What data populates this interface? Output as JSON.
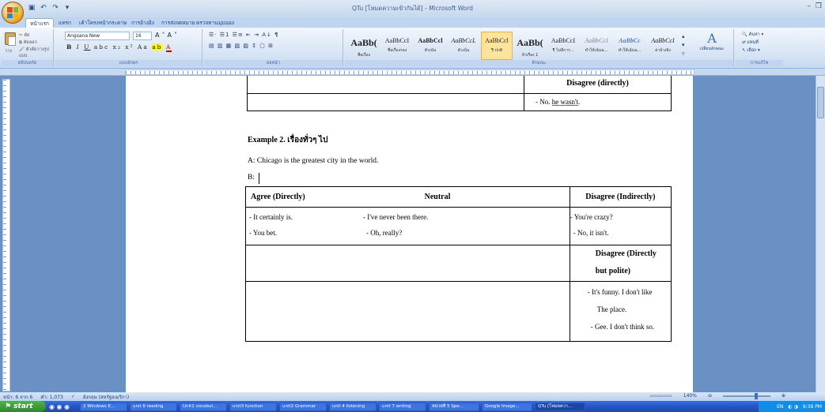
{
  "window": {
    "title": "QTu [โหมดความเข้ากันได้] - Microsoft Word"
  },
  "ribbon": {
    "tabs": [
      "หน้าแรก",
      "แทรก",
      "เค้าโครงหน้ากระดาษ",
      "การอ้างอิง",
      "การส่งจดหมาย",
      "ตรวจทาน",
      "มุมมอง"
    ],
    "clipboard": {
      "label": "คลิปบอร์ด",
      "cut": "ตัด",
      "copy": "คัดลอก",
      "format_painter": "ตัวคัดวางรูปแบบ",
      "paste": "วาง"
    },
    "font": {
      "label": "แบบอักษร",
      "name": "Angsana New",
      "size": "16"
    },
    "paragraph": {
      "label": "ย่อหน้า"
    },
    "styles": {
      "label": "ลักษณะ",
      "items": [
        {
          "sample": "AaBb(",
          "name": "ชื่อเรื่อง"
        },
        {
          "sample": "AaBbCcI",
          "name": "ชื่อเรื่องรอง"
        },
        {
          "sample": "AaBbCcl",
          "name": "ตัวเน้น"
        },
        {
          "sample": "AaBbCcL",
          "name": "ตัวเน้น"
        },
        {
          "sample": "AaBbCcl",
          "name": "¶ ปกติ"
        },
        {
          "sample": "AaBb(",
          "name": "หัวเรื่อง 1"
        },
        {
          "sample": "AaBbCcI",
          "name": "¶ ไม่มีการ..."
        },
        {
          "sample": "AaBbCcI",
          "name": "ทำให้เน้นน..."
        },
        {
          "sample": "AaBbCc",
          "name": "ทำให้เน้นน..."
        },
        {
          "sample": "AaBbCcI",
          "name": "ค่าอ้างอิง"
        }
      ]
    },
    "change_styles": "เปลี่ยนลักษณะ",
    "editing": {
      "label": "การแก้ไข",
      "find": "ค้นหา",
      "replace": "แทนที่",
      "select": "เลือก"
    }
  },
  "document": {
    "top_table": {
      "disagree_header": "Disagree (directly)",
      "answer": "- No. he wasn't.",
      "answer_plain": "- No. ",
      "answer_underlined": "he wasn't"
    },
    "example_title": "Example 2. เรื่องทั่วๆ ไป",
    "line_a": "A:  Chicago is the greatest city in the world.",
    "line_b": "B:",
    "table": {
      "headers": [
        "Agree  (Directly)",
        "Neutral",
        "Disagree  (Indirectly)"
      ],
      "agree": [
        "- It certainly is.",
        "- You bet."
      ],
      "neutral": [
        "- I've never been there.",
        "- Oh, really?"
      ],
      "disagree_indirect": [
        "- You're crazy?",
        "- No, it isn't."
      ],
      "disagree_polite_header": [
        "Disagree  (Directly",
        "but  polite)"
      ],
      "disagree_polite": [
        "- It's funny.  I  don't like",
        "The place.",
        "- Gee. I don't think so."
      ]
    }
  },
  "status": {
    "page": "หน้า: 6 จาก 6",
    "words": "คำ: 1,073",
    "language": "อังกฤษ (สหรัฐอเมริกา)",
    "zoom": "140%"
  },
  "taskbar": {
    "start": "start",
    "items": [
      "2 Windows E...",
      "unit 6 reading",
      "Unit1 vocabul...",
      "unit3 function",
      "unit2 Grammar",
      "unit 4 listening",
      "unit 7 writing",
      "หน่วยที่ 5 Spe...",
      "Google Image...",
      "QTu [โหมดควา..."
    ],
    "lang": "EN",
    "clock": "9:38 PM"
  },
  "colors": {
    "accent": "#15428b",
    "desk": "#6b90c4",
    "taskbar": "#2455c3",
    "start": "#3a9a33"
  }
}
